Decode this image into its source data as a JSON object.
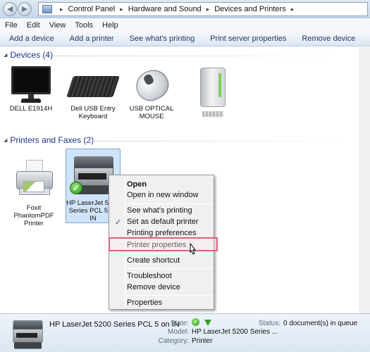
{
  "address_bar": {
    "breadcrumbs": [
      "Control Panel",
      "Hardware and Sound",
      "Devices and Printers"
    ]
  },
  "menu": [
    "File",
    "Edit",
    "View",
    "Tools",
    "Help"
  ],
  "toolbar": {
    "add_device": "Add a device",
    "add_printer": "Add a printer",
    "see_printing": "See what's printing",
    "print_server": "Print server properties",
    "remove_device": "Remove device"
  },
  "devices_group": {
    "header": "Devices (4)",
    "items": [
      {
        "label": "DELL E1914H",
        "icon": "monitor-icon"
      },
      {
        "label": "Dell USB Entry Keyboard",
        "icon": "keyboard-icon"
      },
      {
        "label": "USB OPTICAL MOUSE",
        "icon": "mouse-icon"
      },
      {
        "label": "",
        "icon": "external-drive-icon"
      }
    ]
  },
  "printers_group": {
    "header": "Printers and Faxes (2)",
    "items": [
      {
        "label": "Foxit PhantomPDF Printer",
        "icon": "printer-icon"
      },
      {
        "label": "HP LaserJet 5200 Series PCL 5 on IN",
        "icon": "laser-printer-icon",
        "selected": true,
        "default": true
      }
    ]
  },
  "context_menu": {
    "items": [
      {
        "label": "Open",
        "bold": true
      },
      {
        "label": "Open in new window"
      },
      {
        "label": "See what's printing"
      },
      {
        "label": "Set as default printer",
        "checked": true
      },
      {
        "label": "Printing preferences"
      },
      {
        "label": "Printer properties",
        "highlighted": true
      },
      {
        "label": "Create shortcut"
      },
      {
        "label": "Troubleshoot"
      },
      {
        "label": "Remove device"
      },
      {
        "label": "Properties"
      }
    ]
  },
  "details": {
    "name": "HP LaserJet 5200 Series PCL 5 on IN",
    "state_label": "State:",
    "model_label": "Model:",
    "model_value": "HP LaserJet 5200 Series ...",
    "category_label": "Category:",
    "category_value": "Printer",
    "status_label": "Status:",
    "status_value": "0 document(s) in queue"
  },
  "colors": {
    "group_header": "#1e3287",
    "selection": "#cfe4fa",
    "highlight_box": "#e0607a",
    "accent_green": "#2f9b1f"
  }
}
